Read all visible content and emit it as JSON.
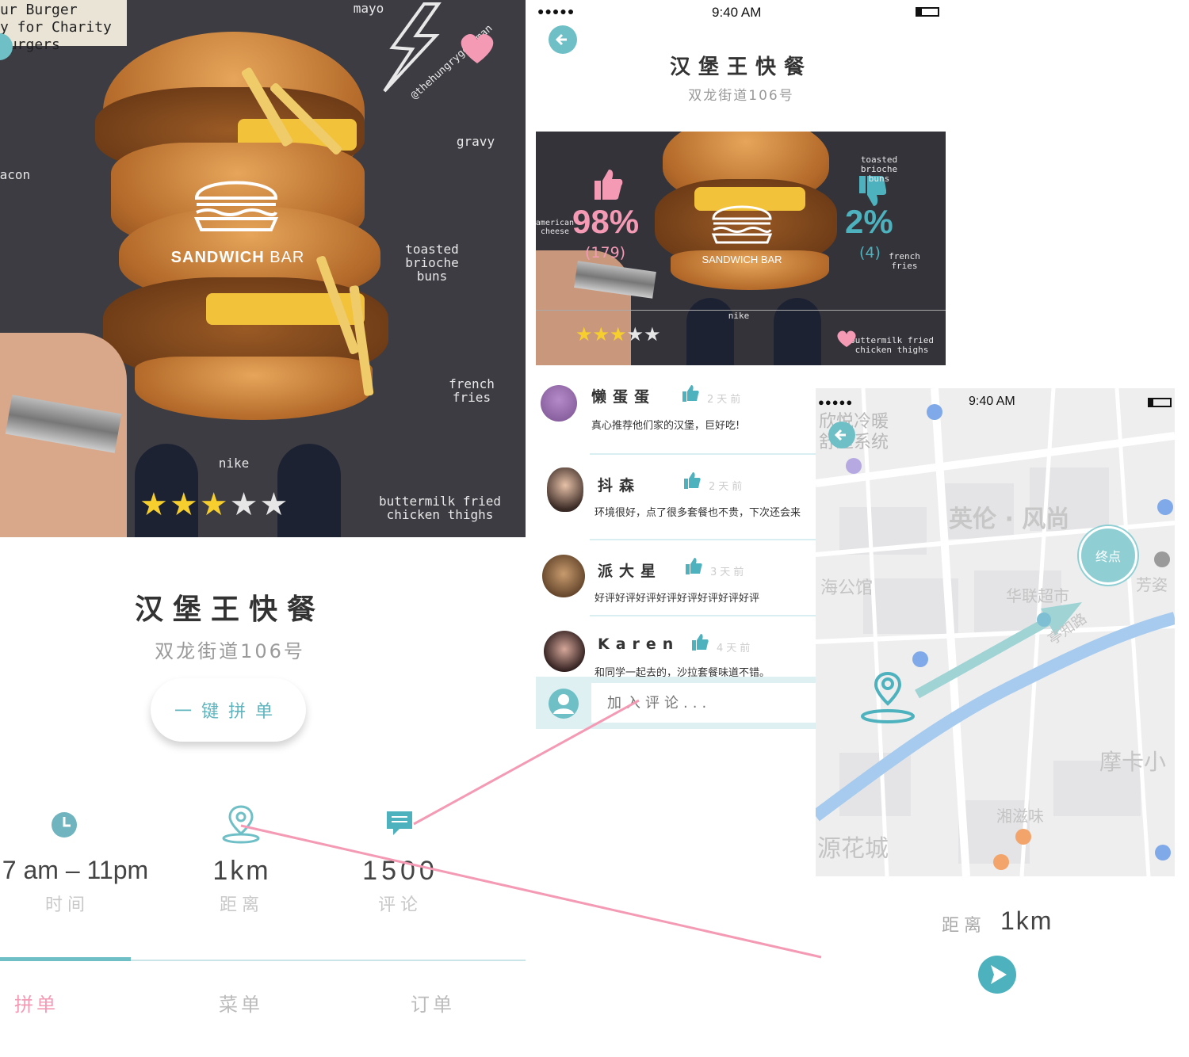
{
  "screen1": {
    "hero": {
      "note_lines": [
        "ur Burger",
        "y for Charity",
        "Burgers"
      ],
      "annotations": {
        "gravy": "gravy",
        "bacon": "bacon",
        "mayo": "mayo",
        "toasted": "toasted\nbrioche\nbuns",
        "fries": "french\nfries",
        "nike": "nike",
        "buttermilk": "buttermilk fried\nchicken thighs",
        "handle": "@thehungryge eman"
      },
      "brand": {
        "main": "SANDWICH",
        "sub": "BAR"
      },
      "rating": {
        "filled": 3,
        "total": 5
      }
    },
    "title": "汉堡王快餐",
    "address": "双龙街道106号",
    "group_button": "一键拼单",
    "stats": {
      "hours": {
        "value": "7 am – 11pm",
        "label": "时间"
      },
      "distance": {
        "value": "1km",
        "label": "距离"
      },
      "comments": {
        "value": "1500",
        "label": "评论"
      }
    },
    "tabs": [
      {
        "label": "拼单",
        "active": true
      },
      {
        "label": "菜单",
        "active": false
      },
      {
        "label": "订单",
        "active": false
      }
    ]
  },
  "screen2": {
    "status": {
      "signal": "●●●●●",
      "time": "9:40 AM"
    },
    "title": "汉堡王快餐",
    "address": "双龙街道106号",
    "photo": {
      "like_pct": "98%",
      "like_count": "(179)",
      "dislike_pct": "2%",
      "dislike_count": "(4)",
      "annot_cheese": "american\ncheese",
      "annot_toasted": "toasted\nbrioche\nbuns",
      "annot_fries": "french\nfries",
      "annot_nike": "nike",
      "annot_buttermilk": "buttermilk fried\nchicken thighs",
      "brand": "SANDWICH BAR",
      "rating": {
        "filled": 3,
        "total": 5
      }
    },
    "reviews": [
      {
        "name": "懒蛋蛋",
        "time": "2天前",
        "text": "真心推荐他们家的汉堡，巨好吃!"
      },
      {
        "name": "抖森",
        "time": "2天前",
        "text": "环境很好，点了很多套餐也不贵，下次还会来"
      },
      {
        "name": "派大星",
        "time": "3天前",
        "text": "好评好评好评好评好评好评好评好评"
      },
      {
        "name": "Karen",
        "time": "4天前",
        "text": "和同学一起去的，沙拉套餐味道不错。"
      }
    ],
    "comment_placeholder": "加入评论..."
  },
  "screen3": {
    "status": {
      "signal": "●●●●●",
      "time": "9:40 AM"
    },
    "map_labels": {
      "top_left": "欣悦冷暖\n舒适系统",
      "district": "英伦 · 风尚",
      "endpoint": "终点",
      "supermarket": "华联超市",
      "road": "亭知路",
      "fang": "芳姿",
      "hall": "海公馆",
      "moka": "摩卡小",
      "xiangzi": "湘滋味",
      "yuanhua": "源花城"
    },
    "distance_label": "距离",
    "distance_value": "1km"
  },
  "colors": {
    "accent": "#6fbfc6",
    "pink": "#f49ab5",
    "star": "#f6cf2e"
  }
}
